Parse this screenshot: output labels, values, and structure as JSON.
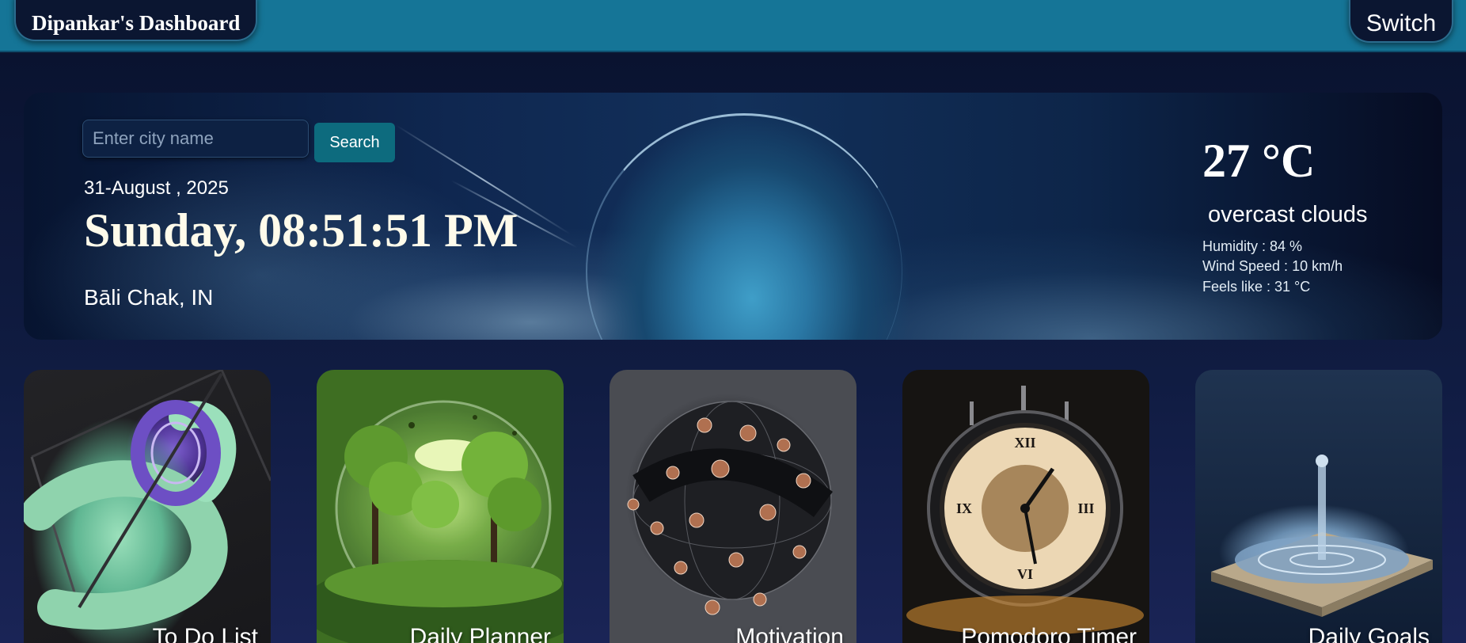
{
  "header": {
    "title": "Dipankar's Dashboard",
    "switch_label": "Switch"
  },
  "hero": {
    "search": {
      "placeholder": "Enter city name",
      "value": "",
      "button_label": "Search"
    },
    "date": "31-August , 2025",
    "clock": "Sunday, 08:51:51 PM",
    "location": "Bāli Chak, IN"
  },
  "weather": {
    "temperature": "27 °C",
    "condition": "overcast clouds",
    "humidity": "Humidity : 84 %",
    "wind": "Wind Speed : 10 km/h",
    "feels_like": "Feels like : 31 °C"
  },
  "cards": [
    {
      "label": "To Do List",
      "icon": "ring-sculpture-image"
    },
    {
      "label": "Daily Planner",
      "icon": "forest-sphere-image"
    },
    {
      "label": "Motivation",
      "icon": "metal-sphere-image"
    },
    {
      "label": "Pomodoro Timer",
      "icon": "clock-image"
    },
    {
      "label": "Daily Goals",
      "icon": "water-drop-image"
    }
  ],
  "colors": {
    "topbar": "#157597",
    "page_bg": "#0b1530",
    "search_button": "#0d6b7e"
  }
}
